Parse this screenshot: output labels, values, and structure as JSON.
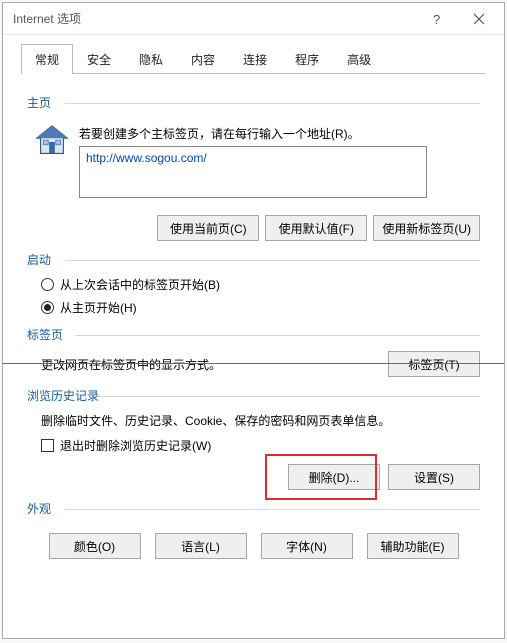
{
  "window": {
    "title": "Internet 选项"
  },
  "tabs": [
    "常规",
    "安全",
    "隐私",
    "内容",
    "连接",
    "程序",
    "高级"
  ],
  "home": {
    "group": "主页",
    "instruction": "若要创建多个主标签页，请在每行输入一个地址(R)。",
    "value": "http://www.sogou.com/",
    "btn_current": "使用当前页(C)",
    "btn_default": "使用默认值(F)",
    "btn_newtab": "使用新标签页(U)"
  },
  "startup": {
    "group": "启动",
    "opt_last": "从上次会话中的标签页开始(B)",
    "opt_home": "从主页开始(H)"
  },
  "tabsect": {
    "group": "标签页",
    "desc": "更改网页在标签页中的显示方式。",
    "btn": "标签页(T)"
  },
  "history": {
    "group": "浏览历史记录",
    "desc": "删除临时文件、历史记录、Cookie、保存的密码和网页表单信息。",
    "check": "退出时删除浏览历史记录(W)",
    "btn_delete": "删除(D)...",
    "btn_settings": "设置(S)"
  },
  "appearance": {
    "group": "外观",
    "btn_color": "颜色(O)",
    "btn_lang": "语言(L)",
    "btn_font": "字体(N)",
    "btn_access": "辅助功能(E)"
  }
}
